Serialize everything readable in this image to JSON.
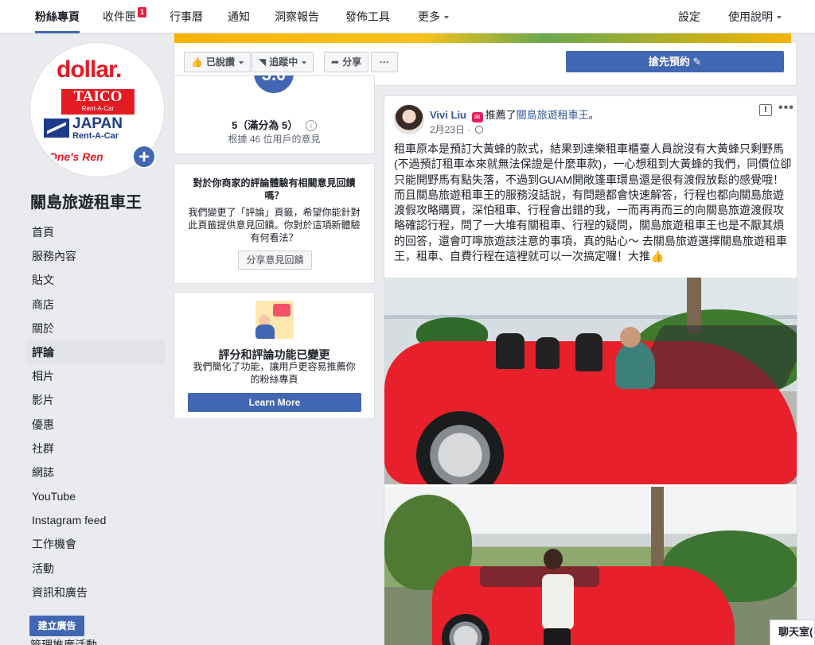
{
  "topnav": {
    "tabs": [
      {
        "label": "粉絲專頁"
      },
      {
        "label": "收件匣",
        "badge": "1"
      },
      {
        "label": "行事曆"
      },
      {
        "label": "通知"
      },
      {
        "label": "洞察報告"
      },
      {
        "label": "發佈工具"
      },
      {
        "label": "更多"
      }
    ],
    "settings": "設定",
    "help": "使用說明"
  },
  "profile": {
    "logo_dollar": "dollar.",
    "logo_taico": "TAICO",
    "logo_taico_sub": "Rent-A-Car",
    "logo_japan": "JAPAN",
    "logo_japan_sub": "Rent-A-Car",
    "logo_ones": "One's Ren",
    "page_name": "關島旅遊租車王"
  },
  "sidebar": {
    "items": [
      {
        "label": "首頁"
      },
      {
        "label": "服務內容"
      },
      {
        "label": "貼文"
      },
      {
        "label": "商店"
      },
      {
        "label": "關於"
      },
      {
        "label": "評論",
        "active": true
      },
      {
        "label": "相片"
      },
      {
        "label": "影片"
      },
      {
        "label": "優惠"
      },
      {
        "label": "社群"
      },
      {
        "label": "網誌"
      },
      {
        "label": "YouTube"
      },
      {
        "label": "Instagram feed"
      },
      {
        "label": "工作機會"
      },
      {
        "label": "活動"
      },
      {
        "label": "資訊和廣告"
      }
    ],
    "create_ad": "建立廣告",
    "partial_item": "管理推廣活動"
  },
  "action_bar": {
    "liked": "已說讚",
    "following": "追蹤中",
    "share": "分享",
    "more": "···",
    "book": "搶先預約"
  },
  "rating_card": {
    "score": "5.0",
    "summary": "5（滿分為 5）",
    "based_on": "根據 46 位用戶的意見"
  },
  "feedback_card": {
    "question": "對於你商家的評論體驗有相關意見回饋嗎？",
    "body": "我們變更了「評論」頁籤，希望你能針對此頁籤提供意見回饋。你對於這項新體驗有何看法？",
    "button": "分享意見回饋"
  },
  "change_card": {
    "title": "評分和評論功能已變更",
    "body": "我們簡化了功能，讓用戶更容易推薦你的粉絲專頁",
    "button": "Learn More"
  },
  "post": {
    "author": "Vivi Liu",
    "verb": "推薦了",
    "page": "關島旅遊租車王",
    "period": "。",
    "date": "2月23日",
    "text": "租車原本是預訂大黃蜂的款式，結果到達樂租車櫃臺人員說沒有大黃蜂只剩野馬(不過預訂租車本來就無法保證是什麼車款)，一心想租到大黃蜂的我們，同價位卻只能開野馬有點失落，不過到GUAM開敞篷車環島還是很有渡假放鬆的感覺哦！ 而且關島旅遊租車王的服務沒話說，有問題都會快速解答，行程也都向關島旅遊渡假攻略購買，深怕租車、行程會出錯的我，一而再再而三的向關島旅遊渡假攻略確認行程，問了一大堆有關租車、行程的疑問，關島旅遊租車王也是不厭其煩的回答，還會叮嚀旅遊該注意的事項，真的貼心～ 去關島旅遊選擇關島旅遊租車王，租車、自費行程在這裡就可以一次搞定囉！大推👍"
  },
  "chat": {
    "label": "聊天室("
  },
  "colors": {
    "brand": "#4267b2",
    "link": "#365899",
    "badge": "#e41e3f",
    "background": "#e9ebee"
  }
}
